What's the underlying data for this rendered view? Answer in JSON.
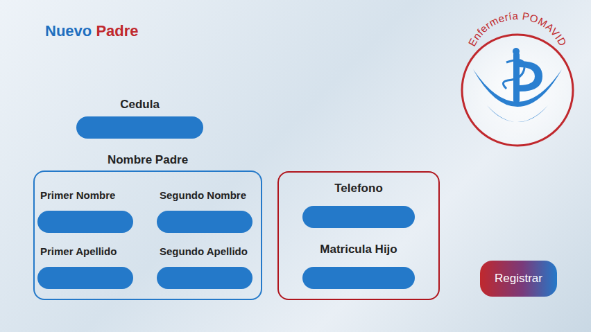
{
  "title": {
    "first": "Nuevo",
    "second": "Padre"
  },
  "logo": {
    "text": "Enfermería POMAVID"
  },
  "cedula": {
    "label": "Cedula",
    "value": ""
  },
  "name_group": {
    "label": "Nombre Padre",
    "fields": [
      {
        "label": "Primer Nombre",
        "value": ""
      },
      {
        "label": "Segundo Nombre",
        "value": ""
      },
      {
        "label": "Primer Apellido",
        "value": ""
      },
      {
        "label": "Segundo Apellido",
        "value": ""
      }
    ]
  },
  "contact_group": {
    "fields": [
      {
        "label": "Telefono",
        "value": ""
      },
      {
        "label": "Matricula Hijo",
        "value": ""
      }
    ]
  },
  "buttons": [
    "Registrar"
  ]
}
